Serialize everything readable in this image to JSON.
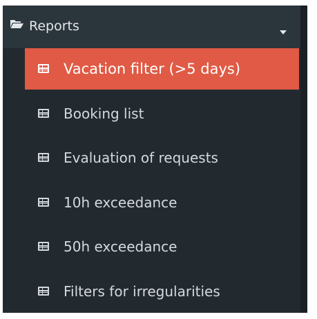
{
  "menu": {
    "header": {
      "label": "Reports",
      "icon": "folder-open-icon",
      "toggle_icon": "caret-down-icon"
    },
    "items": [
      {
        "label": "Vacation filter (>5 days)",
        "icon": "table-icon",
        "active": true
      },
      {
        "label": "Booking list",
        "icon": "table-icon",
        "active": false
      },
      {
        "label": "Evaluation of requests",
        "icon": "table-icon",
        "active": false
      },
      {
        "label": "10h exceedance",
        "icon": "table-icon",
        "active": false
      },
      {
        "label": "50h exceedance",
        "icon": "table-icon",
        "active": false
      },
      {
        "label": "Filters for irregularities",
        "icon": "table-icon",
        "active": false
      }
    ]
  },
  "colors": {
    "panel_background": "#222a30",
    "header_background": "#2b353c",
    "active_background": "#e05a45",
    "text": "#d5d9dd"
  }
}
